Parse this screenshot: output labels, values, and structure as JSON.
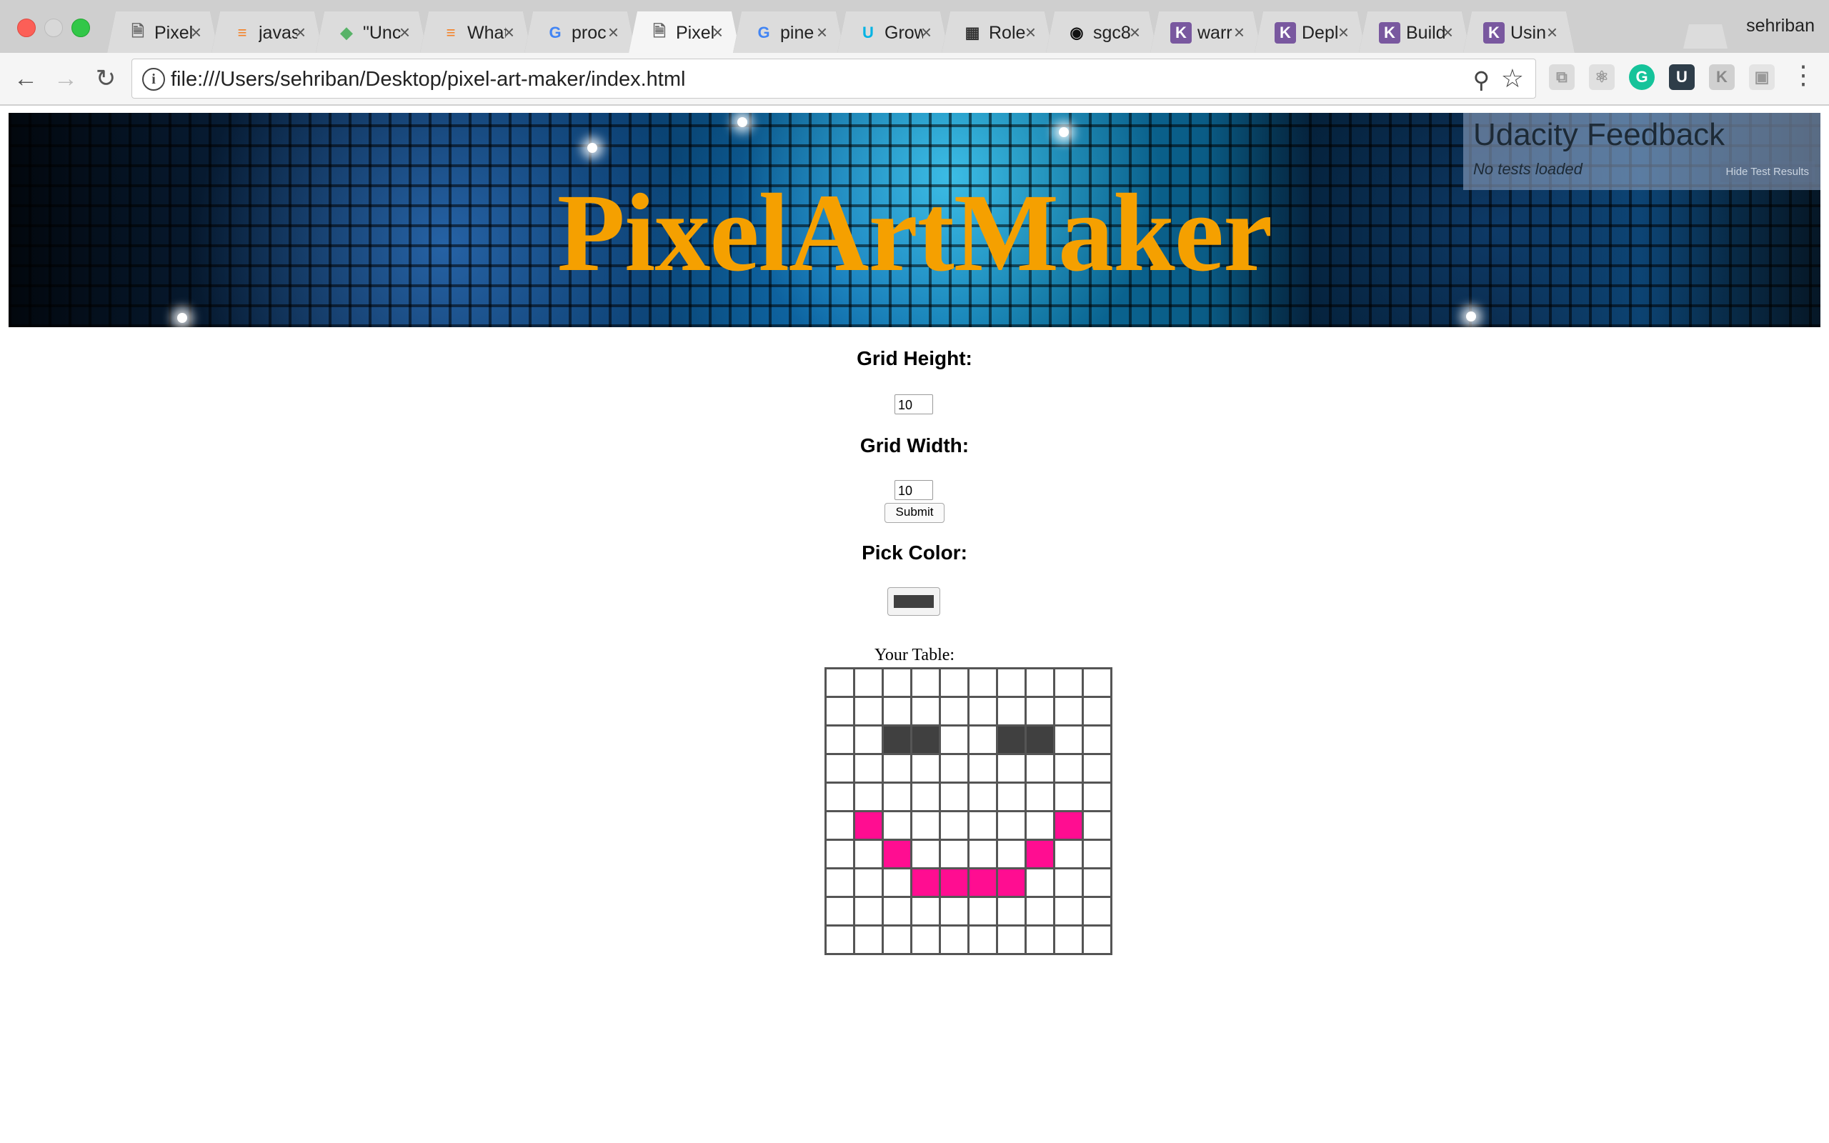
{
  "browser": {
    "tabs": [
      {
        "label": "Pixel",
        "icon": "page-icon",
        "active": false
      },
      {
        "label": "javascript",
        "icon": "stackoverflow-icon",
        "active": false
      },
      {
        "label": "\"Uncaught",
        "icon": "shield-icon",
        "active": false
      },
      {
        "label": "What",
        "icon": "stackoverflow-icon",
        "active": false
      },
      {
        "label": "proc",
        "icon": "google-icon",
        "active": false
      },
      {
        "label": "Pixel",
        "icon": "page-icon",
        "active": true
      },
      {
        "label": "pine",
        "icon": "google-icon",
        "active": false
      },
      {
        "label": "Grow",
        "icon": "udacity-icon",
        "active": false
      },
      {
        "label": "Role",
        "icon": "clipboard-icon",
        "active": false
      },
      {
        "label": "sgc8",
        "icon": "github-icon",
        "active": false
      },
      {
        "label": "warr",
        "icon": "heroku-icon",
        "active": false
      },
      {
        "label": "Depl",
        "icon": "heroku-icon",
        "active": false
      },
      {
        "label": "Build",
        "icon": "heroku-icon",
        "active": false
      },
      {
        "label": "Usin",
        "icon": "heroku-icon",
        "active": false
      }
    ],
    "profile_name": "sehriban",
    "url": "file:///Users/sehriban/Desktop/pixel-art-maker/index.html"
  },
  "banner": {
    "title": "PixelArtMaker"
  },
  "feedback": {
    "title": "Udacity Feedback",
    "status": "No tests loaded",
    "hide_label": "Hide Test Results"
  },
  "form": {
    "height_label": "Grid Height:",
    "height_value": "10",
    "width_label": "Grid Width:",
    "width_value": "10",
    "submit_label": "Submit",
    "color_label": "Pick Color:",
    "color_value": "#404040"
  },
  "table": {
    "caption": "Your Table:",
    "rows": 10,
    "cols": 10,
    "colors": {
      "dark": "#404040",
      "pink": "#ff0d91"
    },
    "painted": [
      {
        "row": 2,
        "col": 2,
        "color": "dark"
      },
      {
        "row": 2,
        "col": 3,
        "color": "dark"
      },
      {
        "row": 2,
        "col": 6,
        "color": "dark"
      },
      {
        "row": 2,
        "col": 7,
        "color": "dark"
      },
      {
        "row": 5,
        "col": 1,
        "color": "pink"
      },
      {
        "row": 5,
        "col": 8,
        "color": "pink"
      },
      {
        "row": 6,
        "col": 2,
        "color": "pink"
      },
      {
        "row": 6,
        "col": 7,
        "color": "pink"
      },
      {
        "row": 7,
        "col": 3,
        "color": "pink"
      },
      {
        "row": 7,
        "col": 4,
        "color": "pink"
      },
      {
        "row": 7,
        "col": 5,
        "color": "pink"
      },
      {
        "row": 7,
        "col": 6,
        "color": "pink"
      }
    ]
  }
}
